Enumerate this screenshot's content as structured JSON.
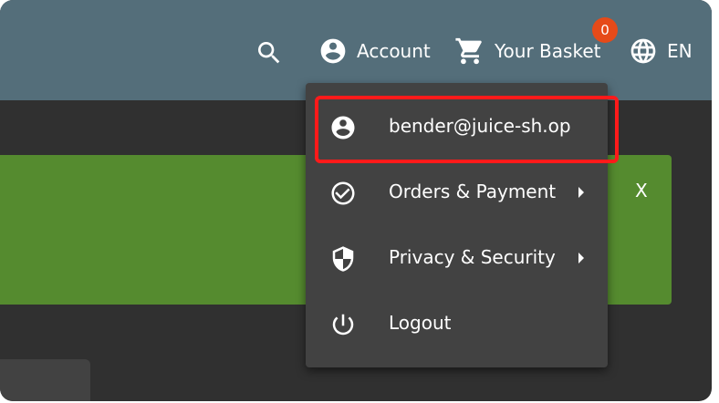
{
  "toolbar": {
    "account_label": "Account",
    "basket_label": "Your Basket",
    "basket_count": "0",
    "language_label": "EN"
  },
  "banner": {
    "close_label": "X"
  },
  "account_menu": {
    "items": [
      {
        "label": "bender@juice-sh.op",
        "icon": "account-circle-icon",
        "has_submenu": false
      },
      {
        "label": "Orders & Payment",
        "icon": "check-circle-icon",
        "has_submenu": true
      },
      {
        "label": "Privacy & Security",
        "icon": "shield-icon",
        "has_submenu": true
      },
      {
        "label": "Logout",
        "icon": "power-icon",
        "has_submenu": false
      }
    ]
  },
  "colors": {
    "toolbar": "#546e7a",
    "background": "#303030",
    "menu": "#424242",
    "banner": "#558b2f",
    "badge": "#e64a19",
    "highlight": "#ff1a1a"
  }
}
